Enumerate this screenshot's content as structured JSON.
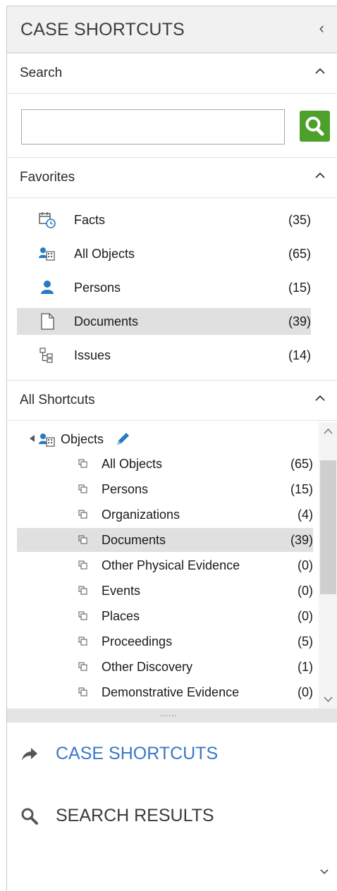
{
  "header": {
    "title": "CASE SHORTCUTS",
    "collapse_glyph": "‹"
  },
  "search_section": {
    "label": "Search",
    "input_value": ""
  },
  "favorites": {
    "label": "Favorites",
    "items": [
      {
        "label": "Facts",
        "count": "(35)",
        "icon": "facts-calendar-icon"
      },
      {
        "label": "All Objects",
        "count": "(65)",
        "icon": "all-objects-icon"
      },
      {
        "label": "Persons",
        "count": "(15)",
        "icon": "person-icon"
      },
      {
        "label": "Documents",
        "count": "(39)",
        "icon": "document-icon",
        "selected": true
      },
      {
        "label": "Issues",
        "count": "(14)",
        "icon": "issues-tree-icon"
      }
    ]
  },
  "all_shortcuts": {
    "label": "All Shortcuts",
    "root": {
      "label": "Objects"
    },
    "items": [
      {
        "label": "All Objects",
        "count": "(65)"
      },
      {
        "label": "Persons",
        "count": "(15)"
      },
      {
        "label": "Organizations",
        "count": "(4)"
      },
      {
        "label": "Documents",
        "count": "(39)",
        "selected": true
      },
      {
        "label": "Other Physical Evidence",
        "count": "(0)"
      },
      {
        "label": "Events",
        "count": "(0)"
      },
      {
        "label": "Places",
        "count": "(0)"
      },
      {
        "label": "Proceedings",
        "count": "(5)"
      },
      {
        "label": "Other Discovery",
        "count": "(1)"
      },
      {
        "label": "Demonstrative Evidence",
        "count": "(0)"
      }
    ]
  },
  "splitter": {
    "dots": "......"
  },
  "nav": {
    "case_shortcuts": "CASE SHORTCUTS",
    "search_results": "SEARCH RESULTS"
  },
  "colors": {
    "accent_blue": "#3a78c7",
    "search_green": "#4fa02a",
    "selection_gray": "#e0e0e0"
  }
}
